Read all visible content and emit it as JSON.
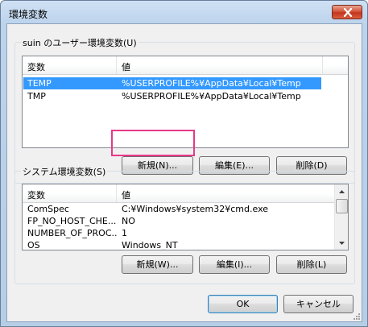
{
  "window": {
    "title": "環境変数"
  },
  "user_section": {
    "label": "suin のユーザー環境変数(U)",
    "columns": {
      "name": "変数",
      "value": "値"
    },
    "rows": [
      {
        "name": "TEMP",
        "value": "%USERPROFILE%¥AppData¥Local¥Temp",
        "selected": true
      },
      {
        "name": "TMP",
        "value": "%USERPROFILE%¥AppData¥Local¥Temp",
        "selected": false
      }
    ],
    "buttons": {
      "new": "新規(N)...",
      "edit": "編集(E)...",
      "delete": "削除(D)"
    }
  },
  "system_section": {
    "label": "システム環境変数(S)",
    "columns": {
      "name": "変数",
      "value": "値"
    },
    "rows": [
      {
        "name": "ComSpec",
        "value": "C:¥Windows¥system32¥cmd.exe",
        "selected": false
      },
      {
        "name": "FP_NO_HOST_CHE...",
        "value": "NO",
        "selected": false
      },
      {
        "name": "NUMBER_OF_PROC...",
        "value": "1",
        "selected": false
      },
      {
        "name": "OS",
        "value": "Windows_NT",
        "selected": false
      }
    ],
    "buttons": {
      "new": "新規(W)...",
      "edit": "編集(I)...",
      "delete": "削除(L)"
    }
  },
  "footer": {
    "ok": "OK",
    "cancel": "キャンセル"
  },
  "colors": {
    "selection": "#3399ff",
    "highlight_box": "#e8388a",
    "close_button": "#c3361c"
  }
}
